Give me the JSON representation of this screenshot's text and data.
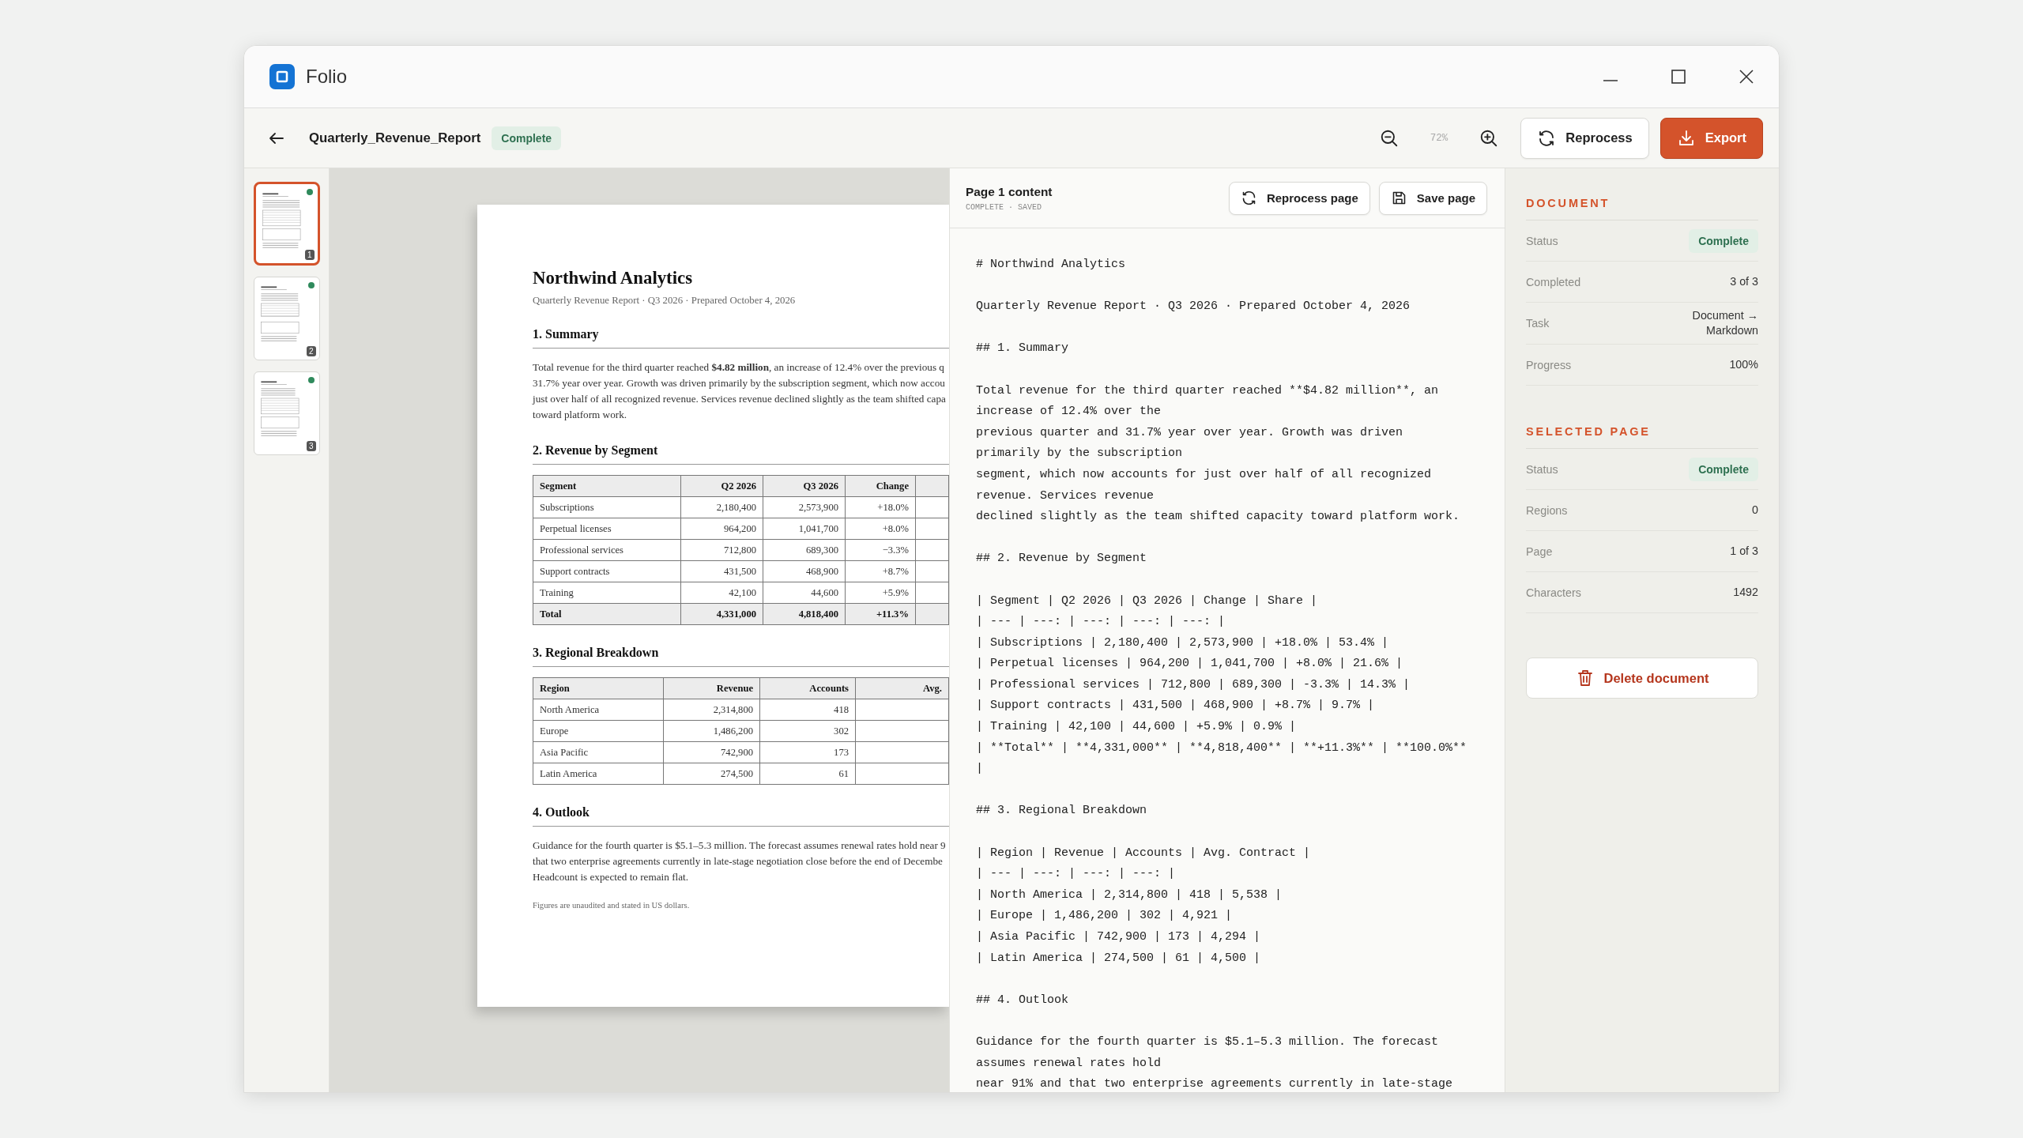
{
  "window": {
    "title": "Folio"
  },
  "toolbar": {
    "document_name": "Quarterly_Revenue_Report",
    "status": "Complete",
    "zoom": "72%",
    "buttons": [
      {
        "label": "Reprocess",
        "kind": "reprocess"
      },
      {
        "label": "Export",
        "kind": "export"
      }
    ]
  },
  "thumbnails": [
    {
      "number": "1",
      "selected": true,
      "complete": true
    },
    {
      "number": "2",
      "selected": false,
      "complete": true
    },
    {
      "number": "3",
      "selected": false,
      "complete": true
    }
  ],
  "document_page": {
    "title": "Northwind Analytics",
    "subtitle": "Quarterly Revenue Report · Q3 2026 · Prepared October 4, 2026",
    "sections": [
      {
        "heading": "1. Summary",
        "kind": "paragraph",
        "lines": [
          "Total revenue for the third quarter reached **$4.82 million**, an increase of 12.4% over the previous q",
          "31.7% year over year. Growth was driven primarily by the subscription segment, which now accou",
          "just over half of all recognized revenue. Services revenue declined slightly as the team shifted capa",
          "toward platform work."
        ]
      },
      {
        "heading": "2. Revenue by Segment",
        "kind": "table",
        "trailing_cut_column": true,
        "columns": [
          "Segment",
          "Q2 2026",
          "Q3 2026",
          "Change"
        ],
        "rows": [
          {
            "kind": "body",
            "cells": [
              "Subscriptions",
              "2,180,400",
              "2,573,900",
              "+18.0%"
            ]
          },
          {
            "kind": "body",
            "cells": [
              "Perpetual licenses",
              "964,200",
              "1,041,700",
              "+8.0%"
            ]
          },
          {
            "kind": "body",
            "cells": [
              "Professional services",
              "712,800",
              "689,300",
              "−3.3%"
            ]
          },
          {
            "kind": "body",
            "cells": [
              "Support contracts",
              "431,500",
              "468,900",
              "+8.7%"
            ]
          },
          {
            "kind": "body",
            "cells": [
              "Training",
              "42,100",
              "44,600",
              "+5.9%"
            ]
          },
          {
            "kind": "total",
            "cells": [
              "Total",
              "4,331,000",
              "4,818,400",
              "+11.3%"
            ]
          }
        ]
      },
      {
        "heading": "3. Regional Breakdown",
        "kind": "table",
        "trailing_cut_column": false,
        "columns": [
          "Region",
          "Revenue",
          "Accounts",
          "Avg."
        ],
        "rows": [
          {
            "kind": "body",
            "cells": [
              "North America",
              "2,314,800",
              "418"
            ]
          },
          {
            "kind": "body",
            "cells": [
              "Europe",
              "1,486,200",
              "302"
            ]
          },
          {
            "kind": "body",
            "cells": [
              "Asia Pacific",
              "742,900",
              "173"
            ]
          },
          {
            "kind": "body",
            "cells": [
              "Latin America",
              "274,500",
              "61"
            ]
          }
        ]
      },
      {
        "heading": "4. Outlook",
        "kind": "paragraph",
        "lines": [
          "Guidance for the fourth quarter is $5.1–5.3 million. The forecast assumes renewal rates hold near 9",
          "that two enterprise agreements currently in late-stage negotiation close before the end of Decembe",
          "Headcount is expected to remain flat."
        ]
      }
    ],
    "footnote": "Figures are unaudited and stated in US dollars."
  },
  "content_pane": {
    "title": "Page 1 content",
    "status": "COMPLETE · SAVED",
    "buttons": [
      {
        "label": "Reprocess page",
        "kind": "reprocess"
      },
      {
        "label": "Save page",
        "kind": "save"
      }
    ],
    "blocks": [
      [
        "# Northwind Analytics"
      ],
      [
        "Quarterly Revenue Report · Q3 2026 · Prepared October 4, 2026"
      ],
      [
        "## 1. Summary"
      ],
      [
        "Total revenue for the third quarter reached **$4.82 million**, an",
        "increase of 12.4% over the",
        "previous quarter and 31.7% year over year. Growth was driven",
        "primarily by the subscription",
        "segment, which now accounts for just over half of all recognized",
        "revenue. Services revenue",
        "declined slightly as the team shifted capacity toward platform work."
      ],
      [
        "## 2. Revenue by Segment"
      ],
      [
        "| Segment | Q2 2026 | Q3 2026 | Change | Share |",
        "| --- | ---: | ---: | ---: | ---: |",
        "| Subscriptions | 2,180,400 | 2,573,900 | +18.0% | 53.4% |",
        "| Perpetual licenses | 964,200 | 1,041,700 | +8.0% | 21.6% |",
        "| Professional services | 712,800 | 689,300 | -3.3% | 14.3% |",
        "| Support contracts | 431,500 | 468,900 | +8.7% | 9.7% |",
        "| Training | 42,100 | 44,600 | +5.9% | 0.9% |",
        "| **Total** | **4,331,000** | **4,818,400** | **+11.3%** | **100.0%**",
        "|"
      ],
      [
        "## 3. Regional Breakdown"
      ],
      [
        "| Region | Revenue | Accounts | Avg. Contract |",
        "| --- | ---: | ---: | ---: |",
        "| North America | 2,314,800 | 418 | 5,538 |",
        "| Europe | 1,486,200 | 302 | 4,921 |",
        "| Asia Pacific | 742,900 | 173 | 4,294 |",
        "| Latin America | 274,500 | 61 | 4,500 |"
      ],
      [
        "## 4. Outlook"
      ],
      [
        "Guidance for the fourth quarter is $5.1–5.3 million. The forecast",
        "assumes renewal rates hold",
        "near 91% and that two enterprise agreements currently in late-stage"
      ]
    ]
  },
  "sidebar": {
    "sections": [
      {
        "title": "DOCUMENT",
        "rows": [
          {
            "label": "Status",
            "value": "Complete",
            "kind": "badge"
          },
          {
            "label": "Completed",
            "value": "3 of 3",
            "kind": "text"
          },
          {
            "label": "Task",
            "value": "Document → Markdown",
            "kind": "text"
          },
          {
            "label": "Progress",
            "value": "100%",
            "kind": "text"
          }
        ]
      },
      {
        "title": "SELECTED PAGE",
        "rows": [
          {
            "label": "Status",
            "value": "Complete",
            "kind": "badge"
          },
          {
            "label": "Regions",
            "value": "0",
            "kind": "text"
          },
          {
            "label": "Page",
            "value": "1 of 3",
            "kind": "text"
          },
          {
            "label": "Characters",
            "value": "1492",
            "kind": "text"
          }
        ]
      }
    ],
    "delete_button": "Delete document"
  }
}
